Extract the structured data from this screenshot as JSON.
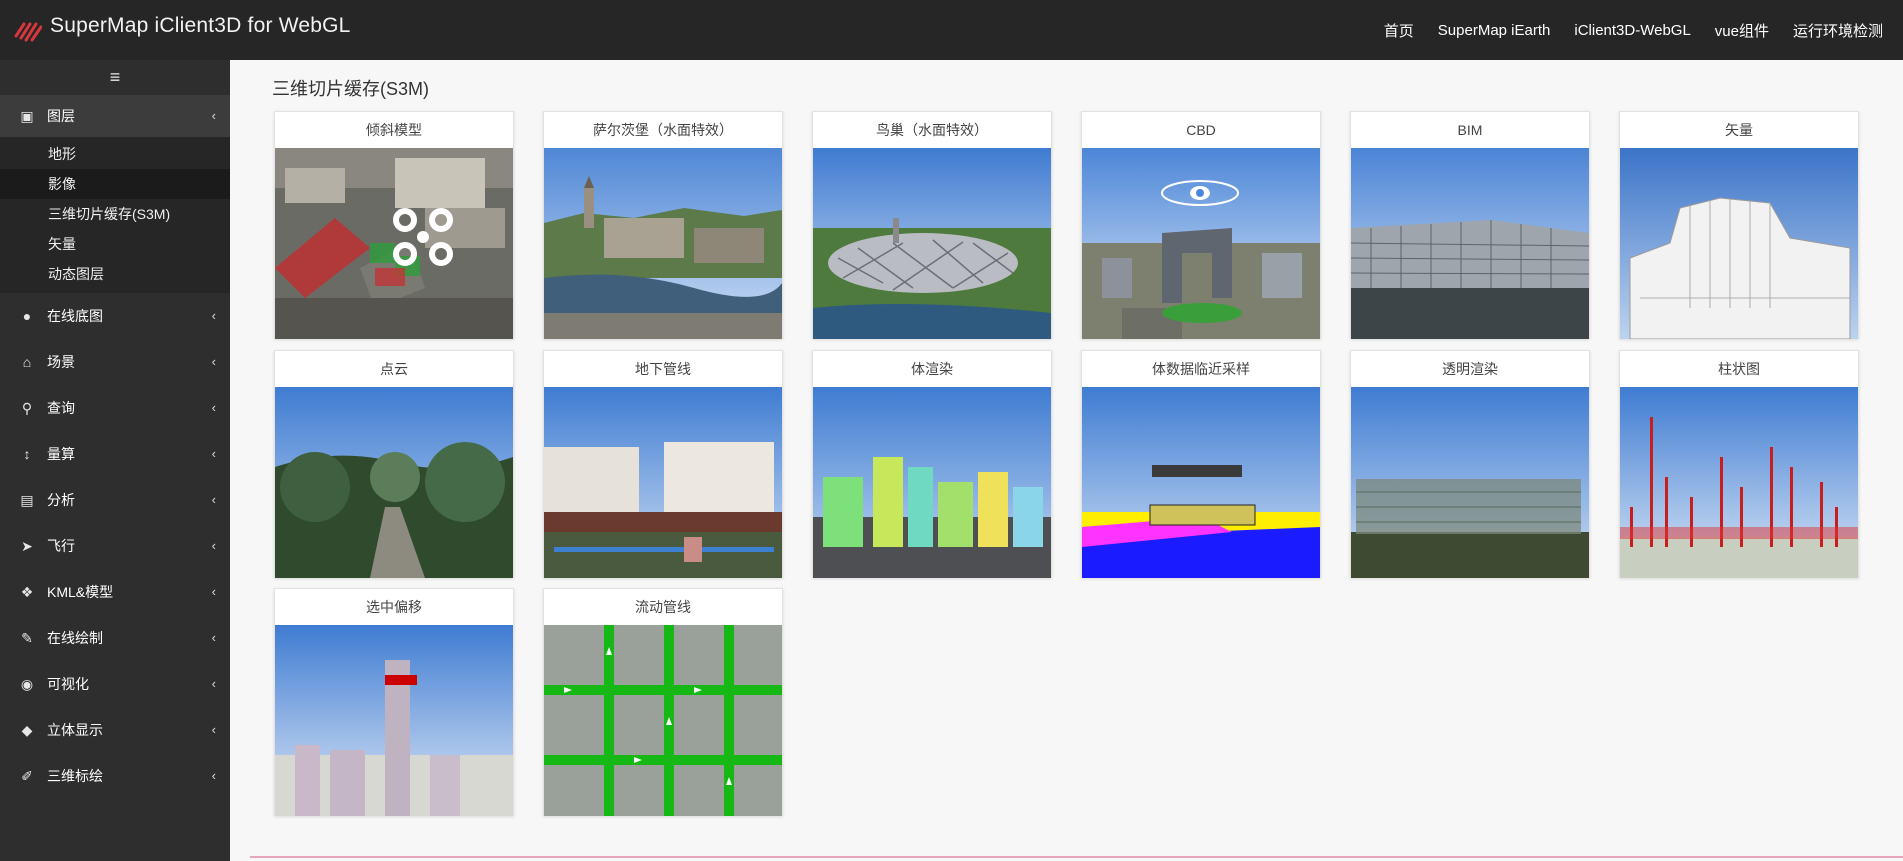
{
  "brand": {
    "title": "SuperMap iClient3D for WebGL",
    "logo_icon": "supermap-logo-icon"
  },
  "nav": [
    {
      "label": "首页"
    },
    {
      "label": "SuperMap iEarth"
    },
    {
      "label": "iClient3D-WebGL"
    },
    {
      "label": "vue组件"
    },
    {
      "label": "运行环境检测"
    }
  ],
  "sidebar": {
    "toggle_icon": "hamburger-icon",
    "toggle_glyph": "≡",
    "chevron_glyph": "‹",
    "layer_group": {
      "label": "图层",
      "icon": "layers-icon",
      "glyph": "▣"
    },
    "sub_items": [
      {
        "label": "地形"
      },
      {
        "label": "影像"
      },
      {
        "label": "三维切片缓存(S3M)"
      },
      {
        "label": "矢量"
      },
      {
        "label": "动态图层"
      }
    ],
    "items": [
      {
        "label": "在线底图",
        "icon": "globe-icon",
        "glyph": "●"
      },
      {
        "label": "场景",
        "icon": "bank-icon",
        "glyph": "⌂"
      },
      {
        "label": "查询",
        "icon": "search-icon",
        "glyph": "⚲"
      },
      {
        "label": "量算",
        "icon": "measure-icon",
        "glyph": "↕"
      },
      {
        "label": "分析",
        "icon": "map-icon",
        "glyph": "▤"
      },
      {
        "label": "飞行",
        "icon": "send-icon",
        "glyph": "➤"
      },
      {
        "label": "KML&模型",
        "icon": "cubes-icon",
        "glyph": "❖"
      },
      {
        "label": "在线绘制",
        "icon": "edit-icon",
        "glyph": "✎"
      },
      {
        "label": "可视化",
        "icon": "eye-icon",
        "glyph": "◉"
      },
      {
        "label": "立体显示",
        "icon": "cube-icon",
        "glyph": "◆"
      },
      {
        "label": "三维标绘",
        "icon": "pencil-icon",
        "glyph": "✐"
      }
    ]
  },
  "content": {
    "section_title": "三维切片缓存(S3M)",
    "cards": [
      {
        "title": "倾斜模型",
        "thumb": "oblique"
      },
      {
        "title": "萨尔茨堡（水面特效）",
        "thumb": "salzburg"
      },
      {
        "title": "鸟巢（水面特效）",
        "thumb": "birdnest"
      },
      {
        "title": "CBD",
        "thumb": "cbd"
      },
      {
        "title": "BIM",
        "thumb": "bim"
      },
      {
        "title": "矢量",
        "thumb": "vector"
      },
      {
        "title": "点云",
        "thumb": "pointcloud"
      },
      {
        "title": "地下管线",
        "thumb": "pipeline"
      },
      {
        "title": "体渲染",
        "thumb": "volume"
      },
      {
        "title": "体数据临近采样",
        "thumb": "sampling"
      },
      {
        "title": "透明渲染",
        "thumb": "transparent"
      },
      {
        "title": "柱状图",
        "thumb": "histogram"
      },
      {
        "title": "选中偏移",
        "thumb": "offset"
      },
      {
        "title": "流动管线",
        "thumb": "flowpipe"
      }
    ]
  }
}
